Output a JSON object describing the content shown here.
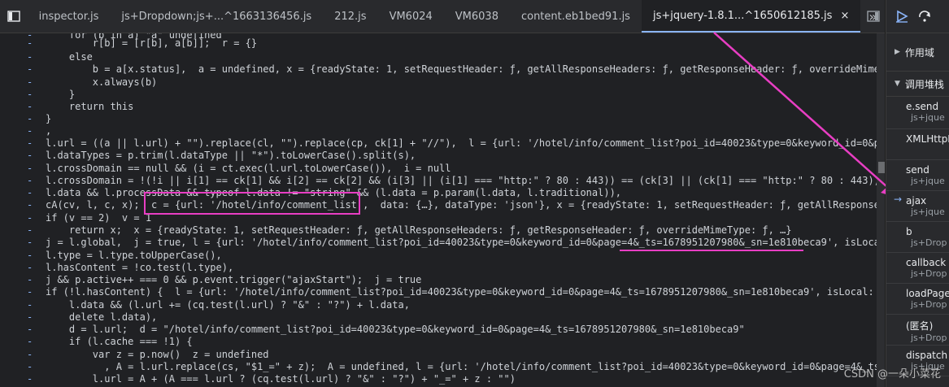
{
  "tabs": [
    {
      "label": "inspector.js",
      "active": false
    },
    {
      "label": "js+Dropdown;js+...^1663136456.js",
      "active": false
    },
    {
      "label": "212.js",
      "active": false
    },
    {
      "label": "VM6024",
      "active": false
    },
    {
      "label": "VM6038",
      "active": false
    },
    {
      "label": "content.eb1bed91.js",
      "active": false
    },
    {
      "label": "js+jquery-1.8.1...^1650612185.js",
      "active": true
    }
  ],
  "tab_close": "×",
  "tab_more": "»",
  "sidebar": {
    "scope_label": "作用域",
    "callstack_label": "调用堆栈",
    "frames": [
      {
        "name": "e.send",
        "file": "js+jque"
      },
      {
        "name": "XMLHttpR",
        "file": ""
      },
      {
        "name": "send",
        "file": "js+jque"
      },
      {
        "name": "ajax",
        "file": "js+jque",
        "current": true
      },
      {
        "name": "b",
        "file": "js+Drop"
      },
      {
        "name": "callback",
        "file": "js+Drop"
      },
      {
        "name": "loadPage",
        "file": "js+Drop"
      },
      {
        "name": "(匿名)",
        "file": "js+Drop"
      },
      {
        "name": "dispatch",
        "file": "js+jque"
      }
    ]
  },
  "code_lines": [
    {
      "text": "    for (b in a) \"a\" undefined"
    },
    {
      "text": "        r[b] = [r[b], a[b]];  r = {}"
    },
    {
      "text": "    else"
    },
    {
      "text": "        b = a[x.status],  a = undefined, x = {readyState: 1, setRequestHeader: ƒ, getAllResponseHeaders: ƒ, getResponseHeader: ƒ, overrideMime"
    },
    {
      "text": "        x.always(b)"
    },
    {
      "text": "    }"
    },
    {
      "text": "    return this"
    },
    {
      "text": "}"
    },
    {
      "text": ","
    },
    {
      "text": "l.url = ((a || l.url) + \"\").replace(cl, \"\").replace(cp, ck[1] + \"//\"),  l = {url: '/hotel/info/comment_list?poi_id=40023&type=0&keyword_id=0&page="
    },
    {
      "text": "l.dataTypes = p.trim(l.dataType || \"*\").toLowerCase().split(s),"
    },
    {
      "text": "l.crossDomain == null && (i = ct.exec(l.url.toLowerCase()),  i = null"
    },
    {
      "text": "l.crossDomain = !(!i || i[1] == ck[1] && i[2] == ck[2] && (i[3] || (i[1] === \"http:\" ? 80 : 443)) == (ck[3] || (ck[1] === \"http:\" ? 80 : 443)))),"
    },
    {
      "text": "l.data && l.processData && typeof l.data != \"string\" && (l.data = p.param(l.data, l.traditional)),"
    },
    {
      "text": "cA(cv, l, c, x);  c = {url: '/hotel/info/comment_list',  data: {…}, dataType: 'json'}, x = {readyState: 1, setRequestHeader: ƒ, getAllResponseHeade"
    },
    {
      "text": "if (v == 2)  v = 1"
    },
    {
      "text": "    return x;  x = {readyState: 1, setRequestHeader: ƒ, getAllResponseHeaders: ƒ, getResponseHeader: ƒ, overrideMimeType: ƒ, …}"
    },
    {
      "text": "j = l.global,  j = true, l = {url: '/hotel/info/comment_list?poi_id=40023&type=0&keyword_id=0&page=4&_ts=1678951207980&_sn=1e810beca9', isLocal: f"
    },
    {
      "text": "l.type = l.type.toUpperCase(),"
    },
    {
      "text": "l.hasContent = !co.test(l.type),"
    },
    {
      "text": "j && p.active++ === 0 && p.event.trigger(\"ajaxStart\");  j = true"
    },
    {
      "text": "if (!l.hasContent) {  l = {url: '/hotel/info/comment_list?poi_id=40023&type=0&keyword_id=0&page=4&_ts=1678951207980&_sn=1e810beca9', isLocal: fals"
    },
    {
      "text": "    l.data && (l.url += (cq.test(l.url) ? \"&\" : \"?\") + l.data,"
    },
    {
      "text": "    delete l.data),"
    },
    {
      "text": "    d = l.url;  d = \"/hotel/info/comment_list?poi_id=40023&type=0&keyword_id=0&page=4&_ts=1678951207980&_sn=1e810beca9\""
    },
    {
      "text": "    if (l.cache === !1) {"
    },
    {
      "text": "        var z = p.now()  z = undefined"
    },
    {
      "text": "          , A = l.url.replace(cs, \"$1_=\" + z);  A = undefined, l = {url: '/hotel/info/comment_list?poi_id=40023&type=0&keyword_id=0&page=4&_ts=167"
    },
    {
      "text": "        l.url = A + (A === l.url ? (cq.test(l.url) ? \"&\" : \"?\") + \"_=\" + z : \"\")"
    }
  ],
  "watermark": "CSDN @一朵小菜花"
}
